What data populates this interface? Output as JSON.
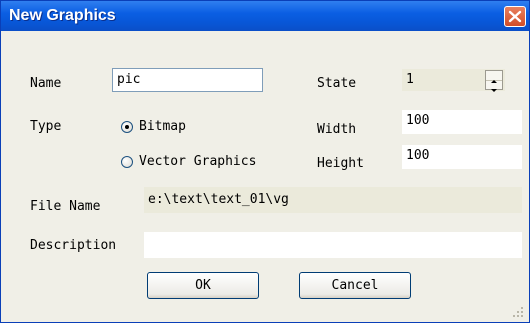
{
  "window": {
    "title": "New Graphics"
  },
  "form": {
    "name_label": "Name",
    "name_value": "pic",
    "type_label": "Type",
    "type_options": [
      "Bitmap",
      "Vector Graphics"
    ],
    "type_selected": "Bitmap",
    "state_label": "State",
    "state_value": "1",
    "width_label": "Width",
    "width_value": "100",
    "height_label": "Height",
    "height_value": "100",
    "filename_label": "File Name",
    "filename_value": "e:\\text\\text_01\\vg",
    "description_label": "Description",
    "description_value": ""
  },
  "buttons": {
    "ok": "OK",
    "cancel": "Cancel"
  },
  "icons": {
    "close": "close-icon",
    "spin_up": "spin-up-icon",
    "spin_down": "spin-down-icon"
  },
  "colors": {
    "titlebar": "#0b5fe3",
    "close_button": "#d24d27",
    "dialog_bg": "#f0efe7"
  }
}
